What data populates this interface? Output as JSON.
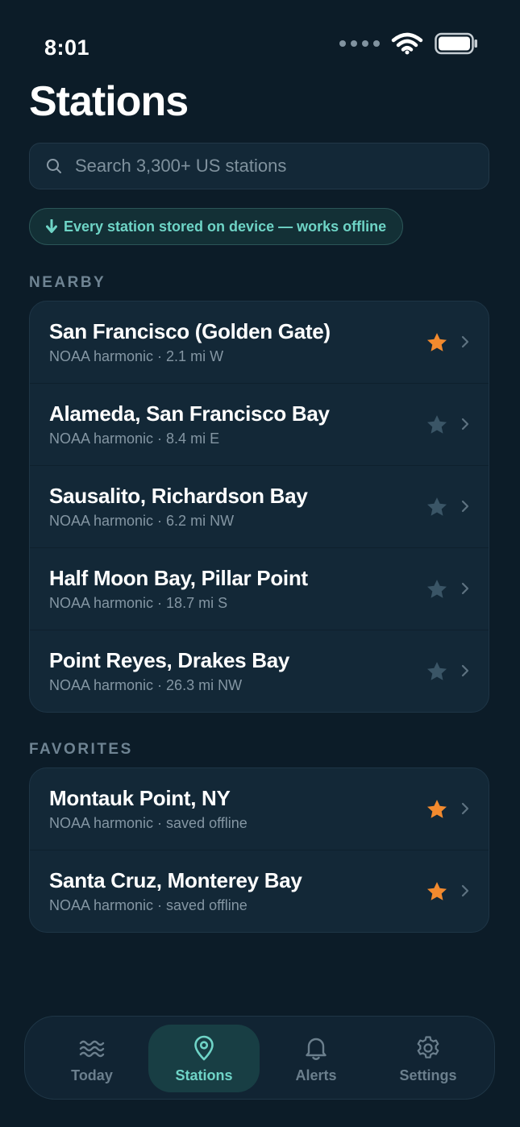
{
  "status": {
    "time": "8:01"
  },
  "page": {
    "title": "Stations"
  },
  "search": {
    "placeholder": "Search 3,300+ US stations"
  },
  "offline_banner": {
    "text": "Every station stored on device — works offline"
  },
  "colors": {
    "accent": "#6fd4c7",
    "star_active": "#f28a2e",
    "star_inactive": "#3a5566",
    "background": "#0c1c28",
    "card": "#132837"
  },
  "nearby": {
    "label": "NEARBY",
    "items": [
      {
        "name": "San Francisco (Golden Gate)",
        "detail": "NOAA harmonic · 2.1 mi W",
        "favorite": true
      },
      {
        "name": "Alameda, San Francisco Bay",
        "detail": "NOAA harmonic · 8.4 mi E",
        "favorite": false
      },
      {
        "name": "Sausalito, Richardson Bay",
        "detail": "NOAA harmonic · 6.2 mi NW",
        "favorite": false
      },
      {
        "name": "Half Moon Bay, Pillar Point",
        "detail": "NOAA harmonic · 18.7 mi S",
        "favorite": false
      },
      {
        "name": "Point Reyes, Drakes Bay",
        "detail": "NOAA harmonic · 26.3 mi NW",
        "favorite": false
      }
    ]
  },
  "favorites": {
    "label": "FAVORITES",
    "items": [
      {
        "name": "Montauk Point, NY",
        "detail": "NOAA harmonic · saved offline",
        "favorite": true
      },
      {
        "name": "Santa Cruz, Monterey Bay",
        "detail": "NOAA harmonic · saved offline",
        "favorite": true
      }
    ]
  },
  "tabs": [
    {
      "label": "Today",
      "icon": "waves-icon",
      "active": false
    },
    {
      "label": "Stations",
      "icon": "map-pin-icon",
      "active": true
    },
    {
      "label": "Alerts",
      "icon": "bell-icon",
      "active": false
    },
    {
      "label": "Settings",
      "icon": "gear-icon",
      "active": false
    }
  ]
}
